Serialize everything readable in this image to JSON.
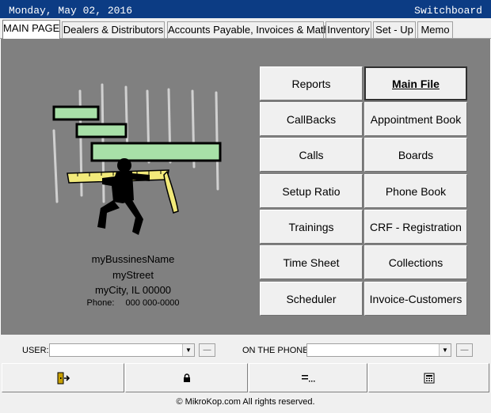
{
  "titlebar": {
    "date": "Monday, May 02, 2016",
    "form_name": "Switchboard"
  },
  "tabs": [
    {
      "label": "MAIN PAGE",
      "active": true
    },
    {
      "label": "Dealers & Distributors"
    },
    {
      "label": "Accounts Payable, Invoices & Math"
    },
    {
      "label": "Inventory"
    },
    {
      "label": "Set - Up"
    },
    {
      "label": "Memo"
    }
  ],
  "business": {
    "name": "myBussinesName",
    "street": "myStreet",
    "city": "myCity, IL 00000",
    "phone_label": "Phone:",
    "phone": "000 000-0000"
  },
  "buttons": {
    "left": [
      "Reports",
      "CallBacks",
      "Calls",
      "Setup Ratio",
      "Trainings",
      "Time Sheet",
      "Scheduler"
    ],
    "right": [
      "Main File",
      "Appointment Book",
      "Boards",
      "Phone Book",
      "CRF - Registration",
      "Collections",
      "Invoice-Customers"
    ]
  },
  "user_bar": {
    "user_label": "USER:",
    "user_value": "",
    "phone_label": "ON THE PHONE:",
    "phone_value": ""
  },
  "action_buttons": [
    "exit-door-icon",
    "lock-icon",
    "equals-dots-icon",
    "calculator-icon"
  ],
  "footer": "© MikroKop.com All rights reserved.",
  "colors": {
    "titlebar": "#0c3c84",
    "panel": "#808080",
    "bar_green": "#a8e0a8"
  }
}
